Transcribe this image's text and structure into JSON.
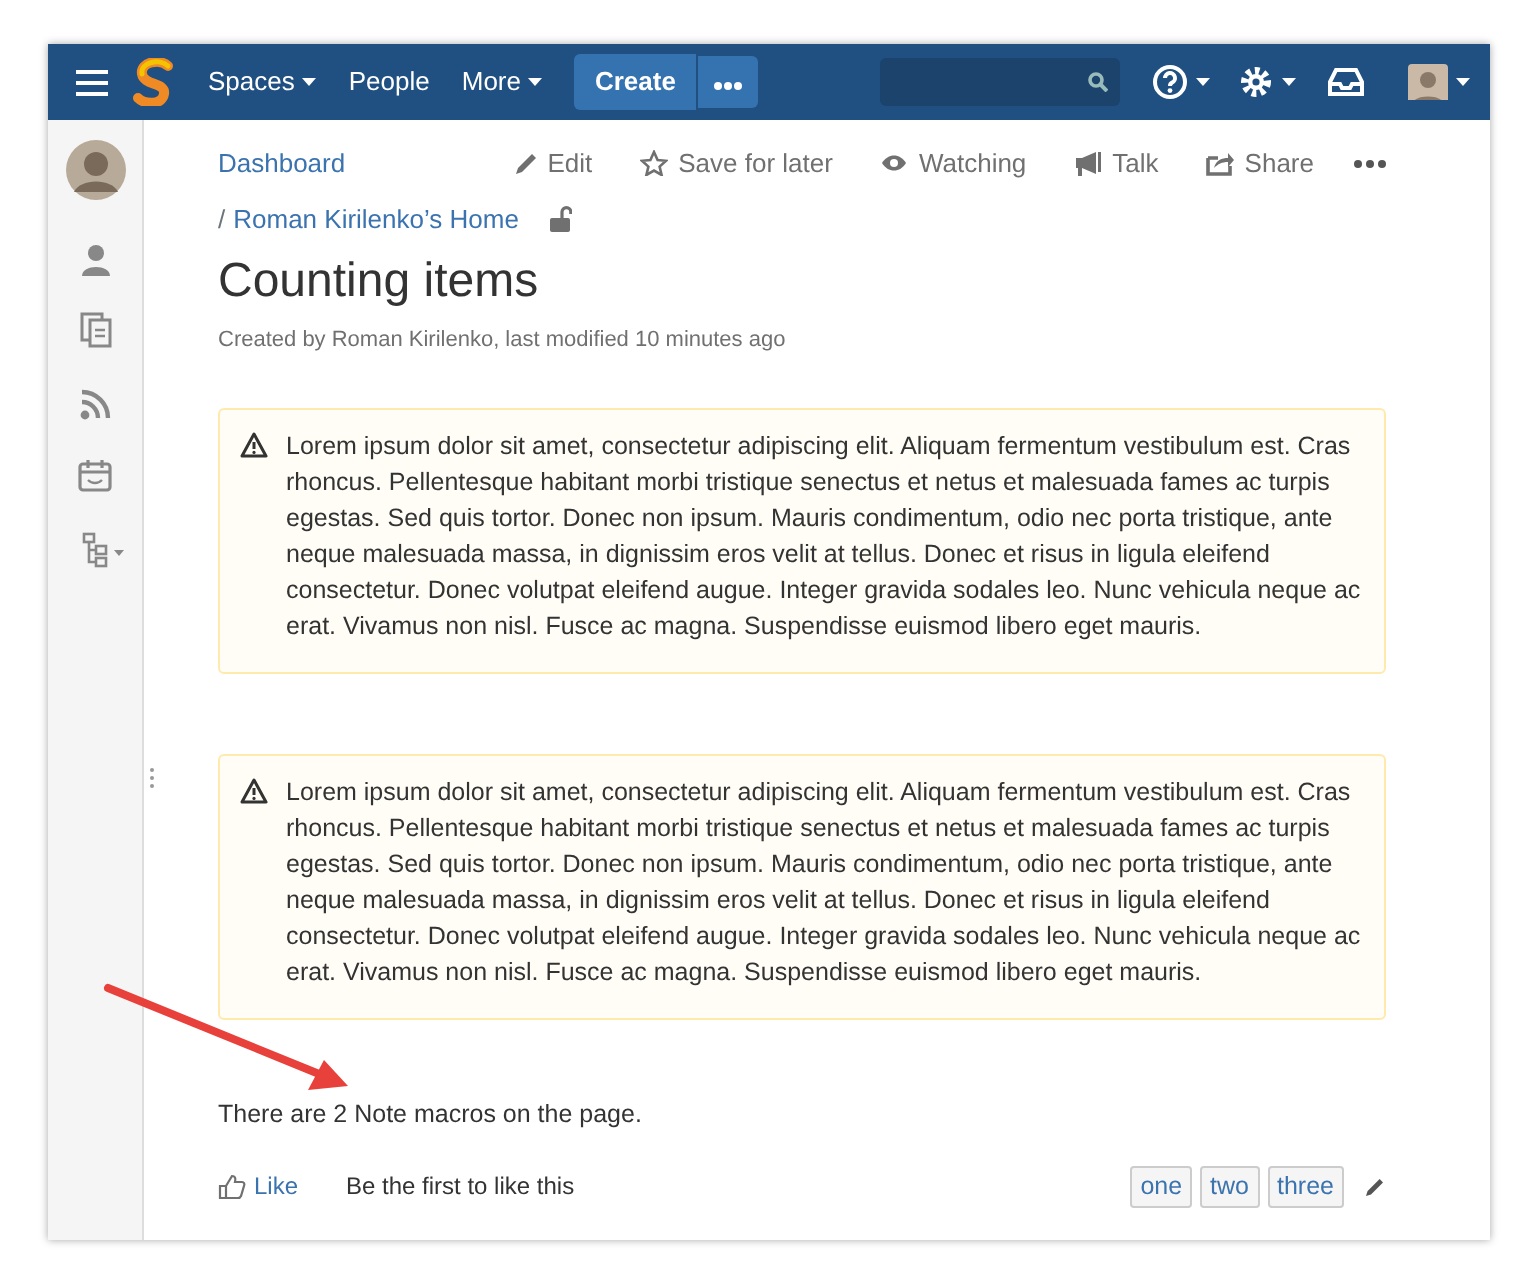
{
  "topbar": {
    "nav": [
      {
        "label": "Spaces",
        "dropdown": true
      },
      {
        "label": "People",
        "dropdown": false
      },
      {
        "label": "More",
        "dropdown": true
      }
    ],
    "create_button": "Create"
  },
  "breadcrumbs": {
    "items": [
      "Dashboard",
      "Roman Kirilenko’s Home"
    ],
    "separator": "/"
  },
  "page_actions": [
    {
      "kind": "edit",
      "label": "Edit"
    },
    {
      "kind": "star",
      "label": "Save for later"
    },
    {
      "kind": "eye",
      "label": "Watching"
    },
    {
      "kind": "megaphone",
      "label": "Talk"
    },
    {
      "kind": "share",
      "label": "Share"
    }
  ],
  "title": "Counting items",
  "byline": "Created by Roman Kirilenko, last modified 10 minutes ago",
  "notes": [
    {
      "text": "Lorem ipsum dolor sit amet, consectetur adipiscing elit. Aliquam fermentum vestibulum est. Cras rhoncus. Pellentesque habitant morbi tristique senectus et netus et malesuada fames ac turpis egestas. Sed quis tortor. Donec non ipsum. Mauris condimentum, odio nec porta tristique, ante neque malesuada massa, in dignissim eros velit at tellus. Donec et risus in ligula eleifend consectetur. Donec volutpat eleifend augue. Integer gravida sodales leo. Nunc vehicula neque ac erat. Vivamus non nisl. Fusce ac magna. Suspendisse euismod libero eget mauris."
    },
    {
      "text": "Lorem ipsum dolor sit amet, consectetur adipiscing elit. Aliquam fermentum vestibulum est. Cras rhoncus. Pellentesque habitant morbi tristique senectus et netus et malesuada fames ac turpis egestas. Sed quis tortor. Donec non ipsum. Mauris condimentum, odio nec porta tristique, ante neque malesuada massa, in dignissim eros velit at tellus. Donec et risus in ligula eleifend consectetur. Donec volutpat eleifend augue. Integer gravida sodales leo. Nunc vehicula neque ac erat. Vivamus non nisl. Fusce ac magna. Suspendisse euismod libero eget mauris."
    }
  ],
  "summary": "There are 2 Note macros on the page.",
  "footer": {
    "like_button": "Like",
    "like_text": "Be the first to like this",
    "labels": [
      "one",
      "two",
      "three"
    ]
  }
}
